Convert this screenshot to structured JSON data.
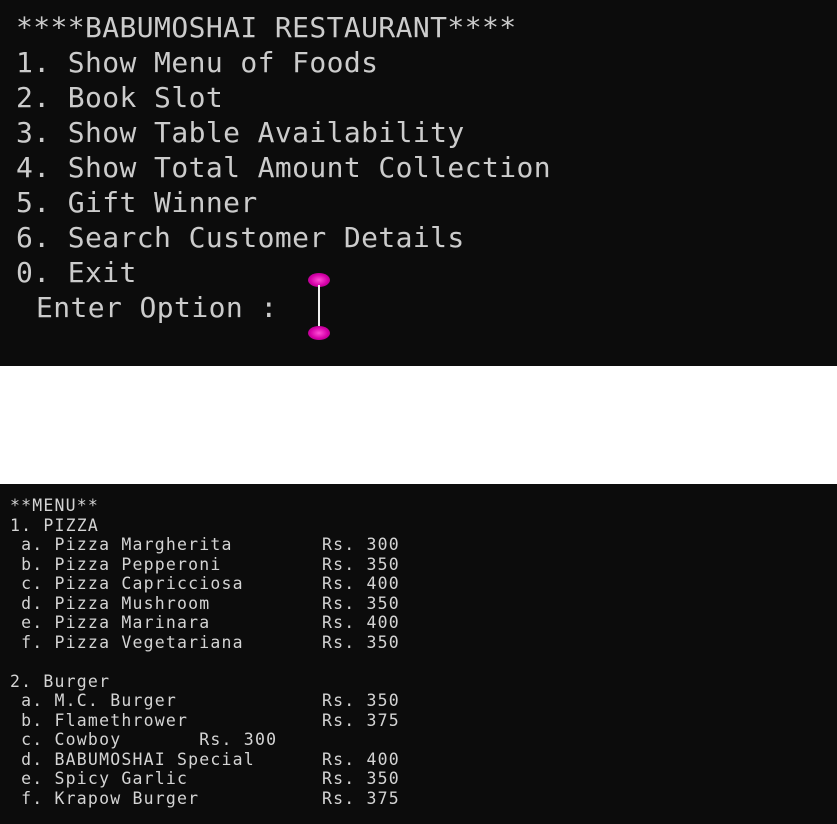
{
  "top_console": {
    "title": "****BABUMOSHAI RESTAURANT****",
    "options": [
      "1. Show Menu of Foods",
      "2. Book Slot",
      "3. Show Table Availability",
      "4. Show Total Amount Collection",
      "5. Gift Winner",
      "6. Search Customer Details",
      "0. Exit"
    ],
    "prompt": "Enter Option :"
  },
  "bottom_console": {
    "header": "**MENU**",
    "sections": [
      {
        "title": "1. PIZZA",
        "items": [
          {
            "name": " a. Pizza Margherita",
            "price": "Rs. 300"
          },
          {
            "name": " b. Pizza Pepperoni",
            "price": "Rs. 350"
          },
          {
            "name": " c. Pizza Capricciosa",
            "price": "Rs. 400"
          },
          {
            "name": " d. Pizza Mushroom",
            "price": "Rs. 350"
          },
          {
            "name": " e. Pizza Marinara",
            "price": "Rs. 400"
          },
          {
            "name": " f. Pizza Vegetariana",
            "price": "Rs. 350"
          }
        ]
      },
      {
        "title": "2. Burger",
        "items": [
          {
            "name": " a. M.C. Burger",
            "price": "Rs. 350"
          },
          {
            "name": " b. Flamethrower",
            "price": "Rs. 375"
          },
          {
            "name": " c. Cowboy       Rs. 300",
            "price": ""
          },
          {
            "name": " d. BABUMOSHAI Special",
            "price": "Rs. 400"
          },
          {
            "name": " e. Spicy Garlic",
            "price": "Rs. 350"
          },
          {
            "name": " f. Krapow Burger",
            "price": "Rs. 375"
          }
        ]
      }
    ]
  },
  "colors": {
    "background": "#0c0c0c",
    "text": "#cccccc",
    "cursor_accent": "#d600a8"
  }
}
